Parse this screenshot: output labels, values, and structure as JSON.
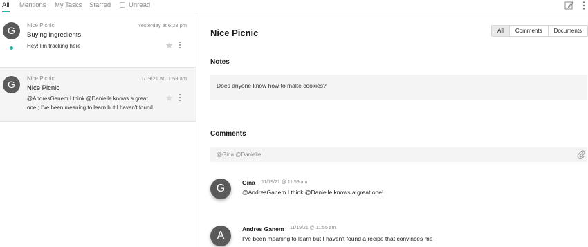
{
  "tabs": [
    {
      "label": "All"
    },
    {
      "label": "Mentions"
    },
    {
      "label": "My Tasks"
    },
    {
      "label": "Starred"
    },
    {
      "label": "Unread"
    }
  ],
  "accent_color": "#2bb5a0",
  "threads": [
    {
      "avatar_letter": "G",
      "channel": "Nice Picnic",
      "time": "Yesterday at 6:23 pm",
      "title": "Buying ingredients",
      "preview": "Hey! I'm tracking here",
      "online": true
    },
    {
      "avatar_letter": "G",
      "channel": "Nice Picnic",
      "time": "11/19/21 at 11:59 am",
      "title": "Nice Picnic",
      "preview": "@AndresGanem I think @Danielle knows a great one!; I've been meaning to learn but I haven't found"
    }
  ],
  "detail": {
    "title": "Nice Picnic",
    "filters": [
      "All",
      "Comments",
      "Documents"
    ],
    "notes_heading": "Notes",
    "notes_text": "Does anyone know how to make cookies?",
    "comments_heading": "Comments",
    "comment_input_value": "@Gina @Danielle",
    "comments": [
      {
        "avatar_letter": "G",
        "author": "Gina",
        "time": "11/19/21 @ 11:59 am",
        "text": "@AndresGanem I think @Danielle knows a great one!"
      },
      {
        "avatar_letter": "A",
        "author": "Andres Ganem",
        "time": "11/19/21 @ 11:55 am",
        "text": "I've been meaning to learn but I haven't found a recipe that convinces me"
      }
    ]
  }
}
